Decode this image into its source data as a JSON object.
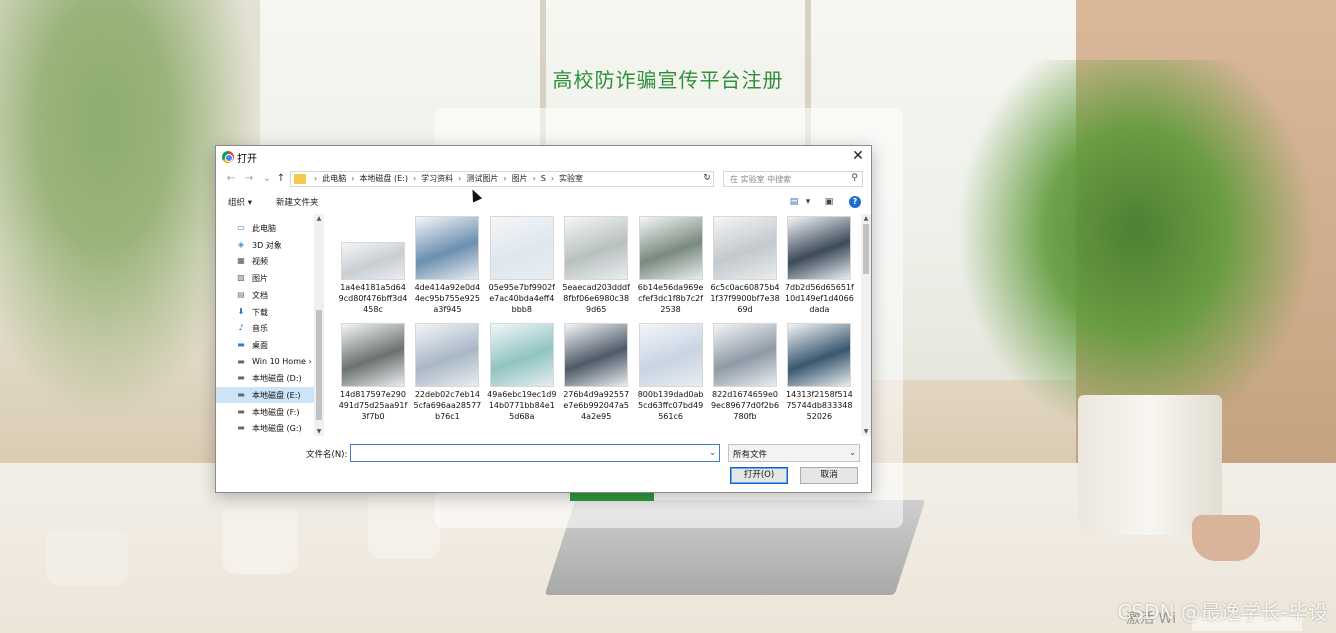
{
  "page": {
    "title": "高校防诈骗宣传平台注册"
  },
  "dialog": {
    "title": "打开",
    "breadcrumbs": [
      "此电脑",
      "本地磁盘 (E:)",
      "学习资料",
      "测试图片",
      "图片",
      "S",
      "实验室"
    ],
    "search_placeholder": "在 实验室 中搜索",
    "toolbar": {
      "organize": "组织 ▾",
      "new_folder": "新建文件夹"
    },
    "nav_items": [
      {
        "label": "此电脑",
        "icon": "computer-icon"
      },
      {
        "label": "3D 对象",
        "icon": "cube-icon"
      },
      {
        "label": "视频",
        "icon": "video-icon"
      },
      {
        "label": "图片",
        "icon": "pictures-icon"
      },
      {
        "label": "文档",
        "icon": "document-icon"
      },
      {
        "label": "下载",
        "icon": "download-icon"
      },
      {
        "label": "音乐",
        "icon": "music-icon"
      },
      {
        "label": "桌面",
        "icon": "desktop-icon"
      },
      {
        "label": "Win 10 Home ›",
        "icon": "drive-icon"
      },
      {
        "label": "本地磁盘 (D:)",
        "icon": "drive-icon"
      },
      {
        "label": "本地磁盘 (E:)",
        "icon": "drive-icon",
        "selected": true
      },
      {
        "label": "本地磁盘 (F:)",
        "icon": "drive-icon"
      },
      {
        "label": "本地磁盘 (G:)",
        "icon": "drive-icon"
      }
    ],
    "files": [
      {
        "name": "1a4e4181a5d649cd80f476bff3d4458c",
        "tone": "#c9ced3"
      },
      {
        "name": "4de414a92e0d44ec95b755e925a3f945",
        "tone": "#6b8fb0"
      },
      {
        "name": "05e95e7bf9902fe7ac40bda4eff4bbb8",
        "tone": "#dfe7ee"
      },
      {
        "name": "5eaecad203dddf8fbf06e6980c389d65",
        "tone": "#b9c1bf"
      },
      {
        "name": "6b14e56da969ecfef3dc1f8b7c2f2538",
        "tone": "#7a8a7e"
      },
      {
        "name": "6c5c0ac60875b41f37f9900bf7e3869d",
        "tone": "#c3c8cc"
      },
      {
        "name": "7db2d56d65651f10d149ef1d4066dada",
        "tone": "#3c4a5a"
      },
      {
        "name": "14d817597e290491d75d25aa91f3f7b0",
        "tone": "#6c7270"
      },
      {
        "name": "22deb02c7eb145cfa696aa28577b76c1",
        "tone": "#a9b7c6"
      },
      {
        "name": "49a6ebc19ec1d914b0771bb84e15d68a",
        "tone": "#8fc4c2"
      },
      {
        "name": "276b4d9a92557e7e6b992047a54a2e95",
        "tone": "#4e5a68"
      },
      {
        "name": "800b139dad0ab5cd63ffc07bd49561c6",
        "tone": "#c8d4e3"
      },
      {
        "name": "822d1674659e09ec89677d0f2b6780fb",
        "tone": "#8e9aa6"
      },
      {
        "name": "14313f2158f51475744db83334852026",
        "tone": "#39576e"
      }
    ],
    "filename_label": "文件名(N):",
    "filename_value": "",
    "filetype_value": "所有文件",
    "open_button": "打开(O)",
    "cancel_button": "取消"
  },
  "watermark": "CSDN @最逸学长-毕设",
  "activate_text": "激活 Wi"
}
